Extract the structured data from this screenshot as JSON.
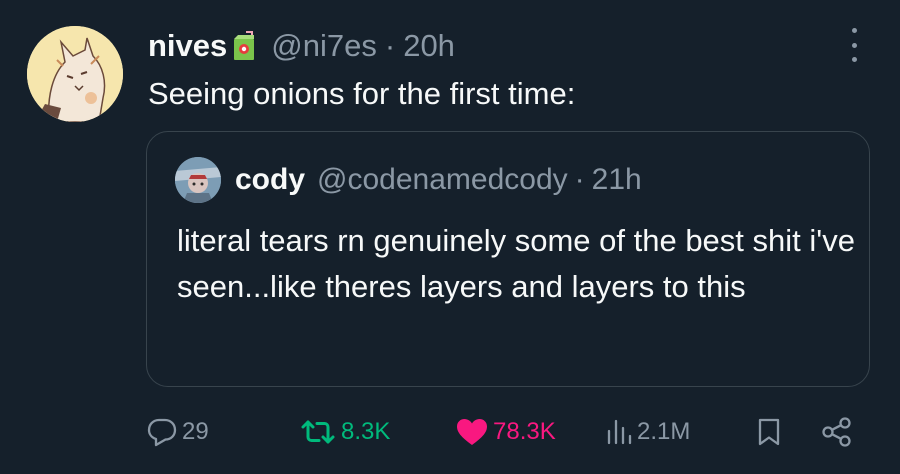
{
  "post": {
    "author": {
      "display_name": "nives",
      "name_emoji": "beverage-box-emoji",
      "handle": "@ni7es",
      "separator": "·",
      "time": "20h"
    },
    "text": "Seeing onions for the first time:",
    "quote": {
      "author": {
        "display_name": "cody",
        "handle": "@codenamedcody",
        "separator": "·",
        "time": "21h"
      },
      "text": "literal tears rn genuinely some of the best shit i've seen...like theres layers and layers to this"
    },
    "actions": {
      "replies": "29",
      "reposts": "8.3K",
      "likes": "78.3K",
      "views": "2.1M"
    },
    "icons": {
      "reply": "reply-icon",
      "repost": "repost-icon",
      "like": "heart-icon",
      "views": "views-icon",
      "bookmark": "bookmark-icon",
      "share": "share-icon",
      "more": "more-icon"
    },
    "colors": {
      "background": "#15202b",
      "text": "#f7f9f9",
      "secondary": "#8b98a5",
      "border": "#38444d",
      "repost_active": "#00ba7c",
      "like_active": "#f91880"
    }
  }
}
